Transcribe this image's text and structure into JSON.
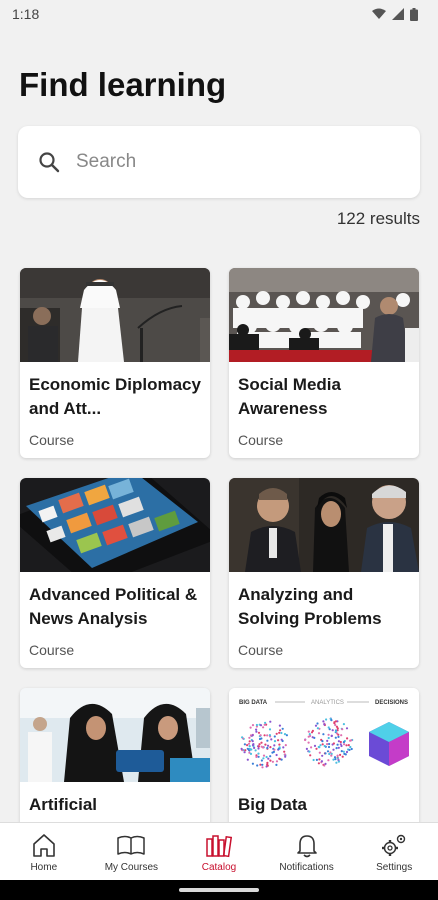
{
  "status_bar": {
    "time": "1:18"
  },
  "header": {
    "title": "Find learning"
  },
  "search": {
    "placeholder": "Search"
  },
  "results": {
    "count_text": "122 results"
  },
  "courses": [
    {
      "title": "Economic Diplomacy and Att...",
      "type": "Course"
    },
    {
      "title": "Social Media Awareness",
      "type": "Course"
    },
    {
      "title": "Advanced Political & News Analysis",
      "type": "Course"
    },
    {
      "title": "Analyzing and Solving Problems",
      "type": "Course"
    },
    {
      "title": "Artificial",
      "type": ""
    },
    {
      "title": "Big Data",
      "type": ""
    }
  ],
  "thumb_texts": {
    "big_data": "BIG DATA",
    "analytics": "ANALYTICS",
    "decisions": "DECISIONS"
  },
  "bottom_nav": [
    {
      "label": "Home",
      "icon": "home-icon"
    },
    {
      "label": "My Courses",
      "icon": "book-icon"
    },
    {
      "label": "Catalog",
      "icon": "catalog-icon",
      "active": true
    },
    {
      "label": "Notifications",
      "icon": "bell-icon"
    },
    {
      "label": "Settings",
      "icon": "gear-icon"
    }
  ],
  "colors": {
    "accent": "#c8102e",
    "background": "#f1f1f1"
  }
}
